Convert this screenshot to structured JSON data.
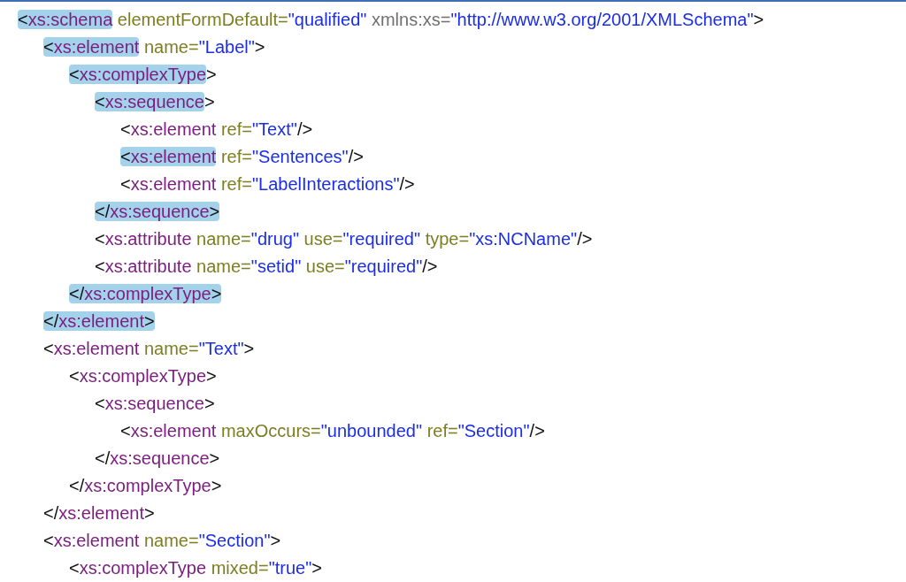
{
  "lines": [
    {
      "tokens": [
        {
          "kind": "punct",
          "text": "<",
          "highlighted": true
        },
        {
          "kind": "tag",
          "text": "xs:schema",
          "highlighted": true
        },
        {
          "kind": "attr",
          "text": " elementFormDefault=",
          "highlighted": false
        },
        {
          "kind": "value",
          "text": "\"qualified\"",
          "highlighted": false
        },
        {
          "kind": "ns",
          "text": " xmlns:xs=",
          "highlighted": false
        },
        {
          "kind": "value",
          "text": "\"http://www.w3.org/2001/XMLSchema\"",
          "highlighted": false
        },
        {
          "kind": "punct",
          "text": ">",
          "highlighted": false
        }
      ],
      "children": [
        {
          "tokens": [
            {
              "kind": "punct",
              "text": "<",
              "highlighted": true
            },
            {
              "kind": "tag",
              "text": "xs:element",
              "highlighted": true
            },
            {
              "kind": "attr",
              "text": " name=",
              "highlighted": false
            },
            {
              "kind": "value",
              "text": "\"Label\"",
              "highlighted": false
            },
            {
              "kind": "punct",
              "text": ">",
              "highlighted": false
            }
          ],
          "children": [
            {
              "tokens": [
                {
                  "kind": "punct",
                  "text": "<",
                  "highlighted": true
                },
                {
                  "kind": "tag",
                  "text": "xs:complexType",
                  "highlighted": true
                },
                {
                  "kind": "punct",
                  "text": ">",
                  "highlighted": false
                }
              ],
              "children": [
                {
                  "tokens": [
                    {
                      "kind": "punct",
                      "text": "<",
                      "highlighted": true
                    },
                    {
                      "kind": "tag",
                      "text": "xs:sequence",
                      "highlighted": true
                    },
                    {
                      "kind": "punct",
                      "text": ">",
                      "highlighted": false
                    }
                  ],
                  "children": [
                    {
                      "tokens": [
                        {
                          "kind": "punct",
                          "text": "<",
                          "highlighted": false
                        },
                        {
                          "kind": "tag",
                          "text": "xs:element",
                          "highlighted": false
                        },
                        {
                          "kind": "attr",
                          "text": " ref=",
                          "highlighted": false
                        },
                        {
                          "kind": "value",
                          "text": "\"Text\"",
                          "highlighted": false
                        },
                        {
                          "kind": "punct",
                          "text": "/>",
                          "highlighted": false
                        }
                      ]
                    },
                    {
                      "tokens": [
                        {
                          "kind": "punct",
                          "text": "<",
                          "highlighted": true
                        },
                        {
                          "kind": "tag",
                          "text": "xs:element",
                          "highlighted": true
                        },
                        {
                          "kind": "attr",
                          "text": " ref=",
                          "highlighted": false
                        },
                        {
                          "kind": "value",
                          "text": "\"Sentences\"",
                          "highlighted": false
                        },
                        {
                          "kind": "punct",
                          "text": "/>",
                          "highlighted": false
                        }
                      ]
                    },
                    {
                      "tokens": [
                        {
                          "kind": "punct",
                          "text": "<",
                          "highlighted": false
                        },
                        {
                          "kind": "tag",
                          "text": "xs:element",
                          "highlighted": false
                        },
                        {
                          "kind": "attr",
                          "text": " ref=",
                          "highlighted": false
                        },
                        {
                          "kind": "value",
                          "text": "\"LabelInteractions\"",
                          "highlighted": false
                        },
                        {
                          "kind": "punct",
                          "text": "/>",
                          "highlighted": false
                        }
                      ]
                    }
                  ]
                },
                {
                  "tokens": [
                    {
                      "kind": "punct",
                      "text": "</",
                      "highlighted": true
                    },
                    {
                      "kind": "tag",
                      "text": "xs:sequence",
                      "highlighted": true
                    },
                    {
                      "kind": "punct",
                      "text": ">",
                      "highlighted": true
                    }
                  ]
                },
                {
                  "tokens": [
                    {
                      "kind": "punct",
                      "text": "<",
                      "highlighted": false
                    },
                    {
                      "kind": "tag",
                      "text": "xs:attribute",
                      "highlighted": false
                    },
                    {
                      "kind": "attr",
                      "text": " name=",
                      "highlighted": false
                    },
                    {
                      "kind": "value",
                      "text": "\"drug\"",
                      "highlighted": false
                    },
                    {
                      "kind": "attr",
                      "text": " use=",
                      "highlighted": false
                    },
                    {
                      "kind": "value",
                      "text": "\"required\"",
                      "highlighted": false
                    },
                    {
                      "kind": "attr",
                      "text": " type=",
                      "highlighted": false
                    },
                    {
                      "kind": "value",
                      "text": "\"xs:NCName\"",
                      "highlighted": false
                    },
                    {
                      "kind": "punct",
                      "text": "/>",
                      "highlighted": false
                    }
                  ]
                },
                {
                  "tokens": [
                    {
                      "kind": "punct",
                      "text": "<",
                      "highlighted": false
                    },
                    {
                      "kind": "tag",
                      "text": "xs:attribute",
                      "highlighted": false
                    },
                    {
                      "kind": "attr",
                      "text": " name=",
                      "highlighted": false
                    },
                    {
                      "kind": "value",
                      "text": "\"setid\"",
                      "highlighted": false
                    },
                    {
                      "kind": "attr",
                      "text": " use=",
                      "highlighted": false
                    },
                    {
                      "kind": "value",
                      "text": "\"required\"",
                      "highlighted": false
                    },
                    {
                      "kind": "punct",
                      "text": "/>",
                      "highlighted": false
                    }
                  ]
                }
              ]
            },
            {
              "tokens": [
                {
                  "kind": "punct",
                  "text": "</",
                  "highlighted": true
                },
                {
                  "kind": "tag",
                  "text": "xs:complexType",
                  "highlighted": true
                },
                {
                  "kind": "punct",
                  "text": ">",
                  "highlighted": true
                }
              ]
            }
          ]
        },
        {
          "tokens": [
            {
              "kind": "punct",
              "text": "</",
              "highlighted": true
            },
            {
              "kind": "tag",
              "text": "xs:element",
              "highlighted": true
            },
            {
              "kind": "punct",
              "text": ">",
              "highlighted": true
            }
          ]
        },
        {
          "tokens": [
            {
              "kind": "punct",
              "text": "<",
              "highlighted": false
            },
            {
              "kind": "tag",
              "text": "xs:element",
              "highlighted": false
            },
            {
              "kind": "attr",
              "text": " name=",
              "highlighted": false
            },
            {
              "kind": "value",
              "text": "\"Text\"",
              "highlighted": false
            },
            {
              "kind": "punct",
              "text": ">",
              "highlighted": false
            }
          ],
          "children": [
            {
              "tokens": [
                {
                  "kind": "punct",
                  "text": "<",
                  "highlighted": false
                },
                {
                  "kind": "tag",
                  "text": "xs:complexType",
                  "highlighted": false
                },
                {
                  "kind": "punct",
                  "text": ">",
                  "highlighted": false
                }
              ],
              "children": [
                {
                  "tokens": [
                    {
                      "kind": "punct",
                      "text": "<",
                      "highlighted": false
                    },
                    {
                      "kind": "tag",
                      "text": "xs:sequence",
                      "highlighted": false
                    },
                    {
                      "kind": "punct",
                      "text": ">",
                      "highlighted": false
                    }
                  ],
                  "children": [
                    {
                      "tokens": [
                        {
                          "kind": "punct",
                          "text": "<",
                          "highlighted": false
                        },
                        {
                          "kind": "tag",
                          "text": "xs:element",
                          "highlighted": false
                        },
                        {
                          "kind": "attr",
                          "text": " maxOccurs=",
                          "highlighted": false
                        },
                        {
                          "kind": "value",
                          "text": "\"unbounded\"",
                          "highlighted": false
                        },
                        {
                          "kind": "attr",
                          "text": " ref=",
                          "highlighted": false
                        },
                        {
                          "kind": "value",
                          "text": "\"Section\"",
                          "highlighted": false
                        },
                        {
                          "kind": "punct",
                          "text": "/>",
                          "highlighted": false
                        }
                      ]
                    }
                  ]
                },
                {
                  "tokens": [
                    {
                      "kind": "punct",
                      "text": "</",
                      "highlighted": false
                    },
                    {
                      "kind": "tag",
                      "text": "xs:sequence",
                      "highlighted": false
                    },
                    {
                      "kind": "punct",
                      "text": ">",
                      "highlighted": false
                    }
                  ]
                }
              ]
            },
            {
              "tokens": [
                {
                  "kind": "punct",
                  "text": "</",
                  "highlighted": false
                },
                {
                  "kind": "tag",
                  "text": "xs:complexType",
                  "highlighted": false
                },
                {
                  "kind": "punct",
                  "text": ">",
                  "highlighted": false
                }
              ]
            }
          ]
        },
        {
          "tokens": [
            {
              "kind": "punct",
              "text": "</",
              "highlighted": false
            },
            {
              "kind": "tag",
              "text": "xs:element",
              "highlighted": false
            },
            {
              "kind": "punct",
              "text": ">",
              "highlighted": false
            }
          ]
        },
        {
          "tokens": [
            {
              "kind": "punct",
              "text": "<",
              "highlighted": false
            },
            {
              "kind": "tag",
              "text": "xs:element",
              "highlighted": false
            },
            {
              "kind": "attr",
              "text": " name=",
              "highlighted": false
            },
            {
              "kind": "value",
              "text": "\"Section\"",
              "highlighted": false
            },
            {
              "kind": "punct",
              "text": ">",
              "highlighted": false
            }
          ],
          "children": [
            {
              "tokens": [
                {
                  "kind": "punct",
                  "text": "<",
                  "highlighted": false
                },
                {
                  "kind": "tag",
                  "text": "xs:complexType",
                  "highlighted": false
                },
                {
                  "kind": "attr",
                  "text": " mixed=",
                  "highlighted": false
                },
                {
                  "kind": "value",
                  "text": "\"true\"",
                  "highlighted": false
                },
                {
                  "kind": "punct",
                  "text": ">",
                  "highlighted": false
                }
              ]
            }
          ]
        }
      ]
    }
  ]
}
